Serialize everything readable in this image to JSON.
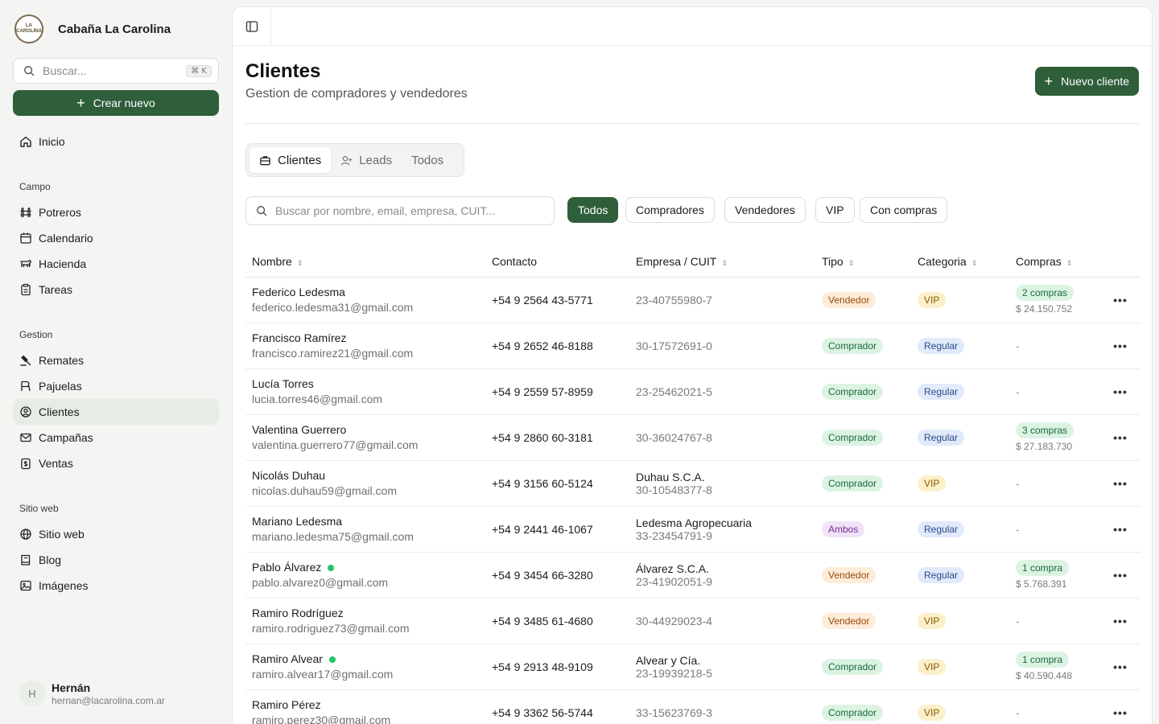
{
  "brand": {
    "name": "Cabaña La Carolina",
    "logo_text": "LA CAROLINA"
  },
  "sidebar": {
    "search_placeholder": "Buscar...",
    "search_shortcut": "⌘ K",
    "create_label": "Crear nuevo",
    "home": "Inicio",
    "sections": [
      {
        "title": "Campo",
        "items": [
          "Potreros",
          "Calendario",
          "Hacienda",
          "Tareas"
        ]
      },
      {
        "title": "Gestion",
        "items": [
          "Remates",
          "Pajuelas",
          "Clientes",
          "Campañas",
          "Ventas"
        ]
      },
      {
        "title": "Sitio web",
        "items": [
          "Sitio web",
          "Blog",
          "Imágenes"
        ]
      }
    ],
    "active": "Clientes"
  },
  "user": {
    "initial": "H",
    "name": "Hernán",
    "email": "hernan@lacarolina.com.ar"
  },
  "page": {
    "title": "Clientes",
    "subtitle": "Gestion de compradores y vendedores",
    "new_button": "Nuevo cliente"
  },
  "tabs": [
    "Clientes",
    "Leads",
    "Todos"
  ],
  "table_search_placeholder": "Buscar por nombre, email, empresa, CUIT...",
  "filters": [
    "Todos",
    "Compradores",
    "Vendedores",
    "VIP",
    "Con compras"
  ],
  "columns": [
    "Nombre",
    "Contacto",
    "Empresa / CUIT",
    "Tipo",
    "Categoria",
    "Compras"
  ],
  "rows": [
    {
      "name": "Federico Ledesma",
      "email": "federico.ledesma31@gmail.com",
      "online": false,
      "phone": "+54 9 2564 43-5771",
      "empresa": "",
      "cuit": "23-40755980-7",
      "tipo": "Vendedor",
      "categoria": "VIP",
      "compras": "2 compras",
      "monto": "$ 24.150.752"
    },
    {
      "name": "Francisco Ramírez",
      "email": "francisco.ramirez21@gmail.com",
      "online": false,
      "phone": "+54 9 2652 46-8188",
      "empresa": "",
      "cuit": "30-17572691-0",
      "tipo": "Comprador",
      "categoria": "Regular",
      "compras": "",
      "monto": "-"
    },
    {
      "name": "Lucía Torres",
      "email": "lucia.torres46@gmail.com",
      "online": false,
      "phone": "+54 9 2559 57-8959",
      "empresa": "",
      "cuit": "23-25462021-5",
      "tipo": "Comprador",
      "categoria": "Regular",
      "compras": "",
      "monto": "-"
    },
    {
      "name": "Valentina Guerrero",
      "email": "valentina.guerrero77@gmail.com",
      "online": false,
      "phone": "+54 9 2860 60-3181",
      "empresa": "",
      "cuit": "30-36024767-8",
      "tipo": "Comprador",
      "categoria": "Regular",
      "compras": "3 compras",
      "monto": "$ 27.183.730"
    },
    {
      "name": "Nicolás Duhau",
      "email": "nicolas.duhau59@gmail.com",
      "online": false,
      "phone": "+54 9 3156 60-5124",
      "empresa": "Duhau S.C.A.",
      "cuit": "30-10548377-8",
      "tipo": "Comprador",
      "categoria": "VIP",
      "compras": "",
      "monto": "-"
    },
    {
      "name": "Mariano Ledesma",
      "email": "mariano.ledesma75@gmail.com",
      "online": false,
      "phone": "+54 9 2441 46-1067",
      "empresa": "Ledesma Agropecuaria",
      "cuit": "33-23454791-9",
      "tipo": "Ambos",
      "categoria": "Regular",
      "compras": "",
      "monto": "-"
    },
    {
      "name": "Pablo Álvarez",
      "email": "pablo.alvarez0@gmail.com",
      "online": true,
      "phone": "+54 9 3454 66-3280",
      "empresa": "Álvarez S.C.A.",
      "cuit": "23-41902051-9",
      "tipo": "Vendedor",
      "categoria": "Regular",
      "compras": "1 compra",
      "monto": "$ 5.768.391"
    },
    {
      "name": "Ramiro Rodríguez",
      "email": "ramiro.rodriguez73@gmail.com",
      "online": false,
      "phone": "+54 9 3485 61-4680",
      "empresa": "",
      "cuit": "30-44929023-4",
      "tipo": "Vendedor",
      "categoria": "VIP",
      "compras": "",
      "monto": "-"
    },
    {
      "name": "Ramiro Alvear",
      "email": "ramiro.alvear17@gmail.com",
      "online": true,
      "phone": "+54 9 2913 48-9109",
      "empresa": "Alvear y Cía.",
      "cuit": "23-19939218-5",
      "tipo": "Comprador",
      "categoria": "VIP",
      "compras": "1 compra",
      "monto": "$ 40.590.448"
    },
    {
      "name": "Ramiro Pérez",
      "email": "ramiro.perez30@gmail.com",
      "online": false,
      "phone": "+54 9 3362 56-5744",
      "empresa": "",
      "cuit": "33-15623769-3",
      "tipo": "Comprador",
      "categoria": "VIP",
      "compras": "",
      "monto": "-"
    }
  ],
  "colors": {
    "primary": "#2e5e3a",
    "online_dot": "#22c55e"
  }
}
